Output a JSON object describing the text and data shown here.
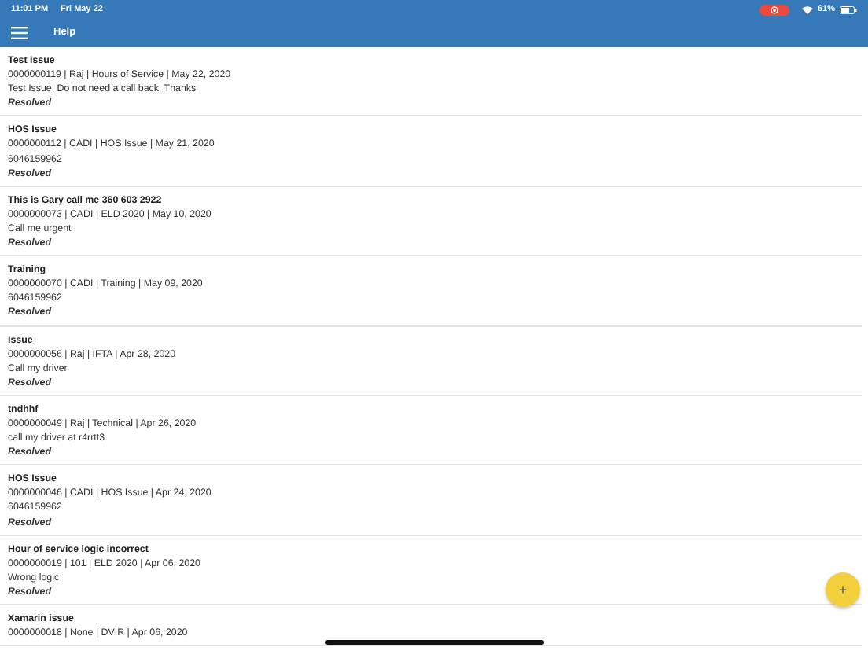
{
  "status_bar": {
    "time": "11:01 PM",
    "date": "Fri May 22",
    "battery": "61%"
  },
  "header": {
    "title": "Help"
  },
  "tickets": [
    {
      "title": "Test Issue",
      "meta": "0000000119  | Raj  | Hours of Service |  May 22, 2020",
      "note": "Test Issue. Do not need a call back. Thanks",
      "status": "Resolved"
    },
    {
      "title": "HOS Issue",
      "meta": "0000000112  | CADI  | HOS Issue |  May 21, 2020",
      "note": "6046159962",
      "status": "Resolved"
    },
    {
      "title": "This is Gary call me 360 603 2922",
      "meta": "0000000073  | CADI  | ELD 2020 |  May 10, 2020",
      "note": "Call me urgent",
      "status": "Resolved"
    },
    {
      "title": "Training",
      "meta": "0000000070  | CADI  | Training |  May 09, 2020",
      "note": "6046159962",
      "status": "Resolved"
    },
    {
      "title": "Issue",
      "meta": "0000000056  | Raj  | IFTA |  Apr 28, 2020",
      "note": "Call my driver",
      "status": "Resolved"
    },
    {
      "title": "tndhhf",
      "meta": "0000000049  | Raj  | Technical |  Apr 26, 2020",
      "note": "call my driver at r4rrtt3",
      "status": "Resolved"
    },
    {
      "title": "HOS Issue",
      "meta": "0000000046  | CADI  | HOS Issue |  Apr 24, 2020",
      "note": "6046159962",
      "status": "Resolved"
    },
    {
      "title": "Hour of service logic incorrect",
      "meta": "0000000019  | 101  | ELD 2020 |  Apr 06, 2020",
      "note": "Wrong logic",
      "status": "Resolved"
    },
    {
      "title": "Xamarin issue",
      "meta": "0000000018  | None  | DVIR |  Apr 06, 2020"
    }
  ],
  "fab": {
    "label": "+"
  }
}
